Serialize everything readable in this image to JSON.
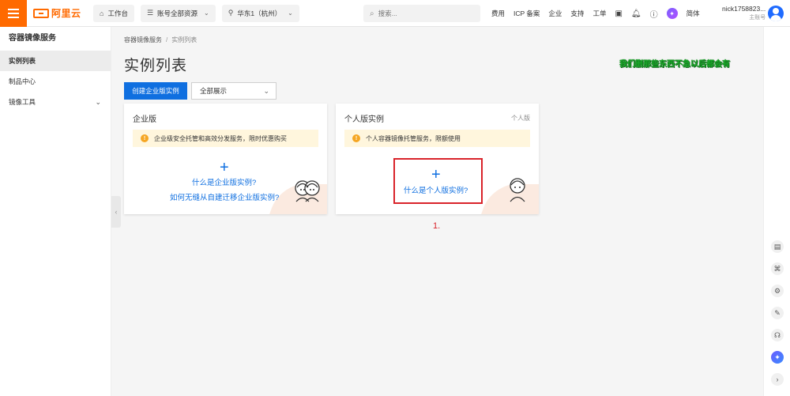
{
  "header": {
    "logo_text": "阿里云",
    "workbench": "工作台",
    "resource_scope": "账号全部资源",
    "region": "华东1（杭州）",
    "search_placeholder": "搜索...",
    "links": [
      "费用",
      "ICP 备案",
      "企业",
      "支持",
      "工单"
    ],
    "language": "简体",
    "user_name": "nick1758823...",
    "user_role": "主账号"
  },
  "sidebar": {
    "title": "容器镜像服务",
    "items": [
      {
        "label": "实例列表",
        "active": true
      },
      {
        "label": "制品中心",
        "active": false
      },
      {
        "label": "镜像工具",
        "active": false,
        "expandable": true
      }
    ]
  },
  "breadcrumb": {
    "root": "容器镜像服务",
    "separator": "/",
    "current": "实例列表"
  },
  "page": {
    "title": "实例列表",
    "annotation": "我们删那些东西不急以后都会有",
    "create_button": "创建企业版实例",
    "filter_value": "全部展示",
    "step_label": "1."
  },
  "cards": {
    "enterprise": {
      "title": "企业版",
      "notice": "企业级安全托管和高效分发服务，限时优惠购买",
      "link_primary": "什么是企业版实例?",
      "link_secondary": "如何无缝从自建迁移企业版实例?"
    },
    "personal": {
      "title": "个人版实例",
      "tag": "个人版",
      "notice": "个人容器镜像托管服务，限额使用",
      "link_primary": "什么是个人版实例?"
    }
  },
  "icons": {
    "menu": "hamburger-icon",
    "workbench": "home-icon",
    "resource": "list-icon",
    "region": "location-pin-icon",
    "search": "search-icon",
    "bell": "bell-icon",
    "help": "help-circle-icon",
    "ai": "sparkle-icon",
    "terminal": "terminal-icon"
  },
  "colors": {
    "brand": "#ff6a00",
    "primary": "#0f6fe0",
    "notice_bg": "#fff6dd",
    "highlight": "#d9232a",
    "annotation": "#1aaa2a"
  }
}
